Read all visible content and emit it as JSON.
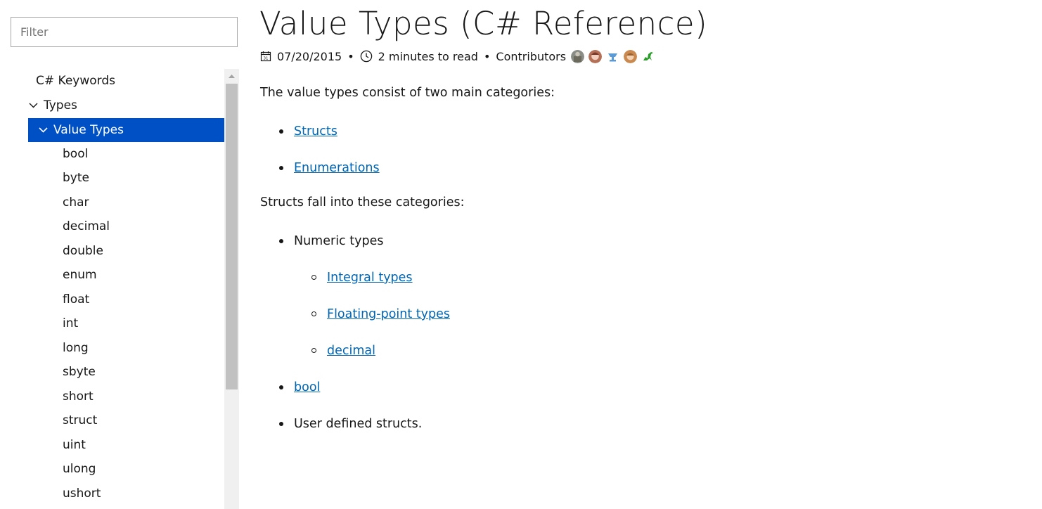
{
  "sidebar": {
    "filter_placeholder": "Filter",
    "toc": [
      {
        "label": "C# Keywords"
      },
      {
        "label": "Types",
        "expanded": true
      },
      {
        "label": "Value Types",
        "expanded": true,
        "selected": true
      },
      {
        "label": "bool"
      },
      {
        "label": "byte"
      },
      {
        "label": "char"
      },
      {
        "label": "decimal"
      },
      {
        "label": "double"
      },
      {
        "label": "enum"
      },
      {
        "label": "float"
      },
      {
        "label": "int"
      },
      {
        "label": "long"
      },
      {
        "label": "sbyte"
      },
      {
        "label": "short"
      },
      {
        "label": "struct"
      },
      {
        "label": "uint"
      },
      {
        "label": "ulong"
      },
      {
        "label": "ushort"
      }
    ]
  },
  "article": {
    "title": "Value Types (C# Reference)",
    "date": "07/20/2015",
    "read_time": "2 minutes to read",
    "separator": "•",
    "contributors_label": "Contributors",
    "contributors": [
      "contributor-avatar-1",
      "contributor-avatar-2",
      "contributor-avatar-3",
      "contributor-avatar-4",
      "contributor-avatar-5"
    ],
    "intro": "The value types consist of two main categories:",
    "categories": [
      "Structs",
      "Enumerations"
    ],
    "structs_intro": "Structs fall into these categories:",
    "numeric_label": "Numeric types",
    "numeric_sub": [
      "Integral types",
      "Floating-point types",
      "decimal"
    ],
    "bool_link": "bool",
    "user_defined": "User defined structs."
  },
  "colors": {
    "selected_bg": "#0050c5",
    "link": "#0065b3",
    "text": "#171717"
  }
}
